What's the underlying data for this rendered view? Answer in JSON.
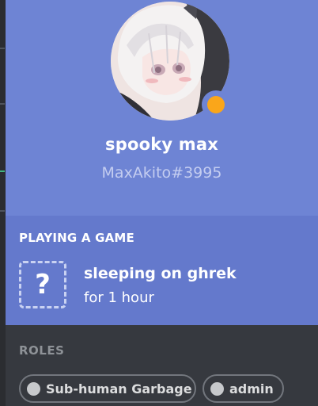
{
  "profile": {
    "username": "spooky max",
    "discriminator": "MaxAkito#3995",
    "status": "idle",
    "status_color": "#faa61a",
    "banner_color": "#6e84d4"
  },
  "activity": {
    "header": "PLAYING A GAME",
    "icon": "question-mark-icon",
    "icon_glyph": "?",
    "game_name": "sleeping on ghrek",
    "elapsed": "for 1 hour"
  },
  "roles": {
    "header": "ROLES",
    "items": [
      {
        "name": "Sub-human Garbage",
        "color": "#c7c9cc"
      },
      {
        "name": "admin",
        "color": "#c7c9cc"
      }
    ]
  }
}
